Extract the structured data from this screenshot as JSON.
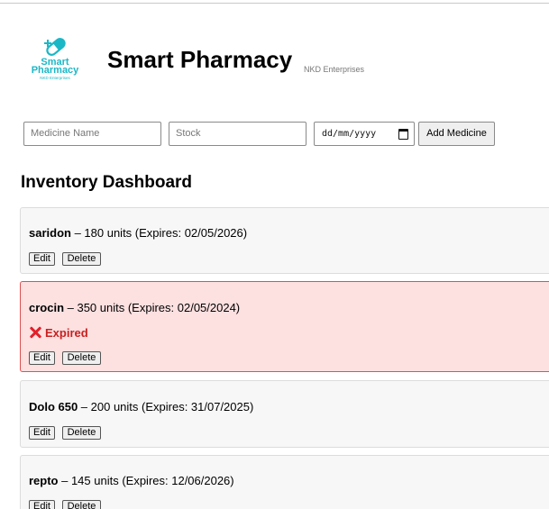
{
  "header": {
    "logo_name_line1": "Smart",
    "logo_name_line2": "Pharmacy",
    "logo_subtitle": "NKD Enterprises",
    "title": "Smart Pharmacy",
    "company": "NKD Enterprises"
  },
  "form": {
    "name_placeholder": "Medicine Name",
    "stock_placeholder": "Stock",
    "date_placeholder": "dd/mm/yyyy",
    "add_label": "Add Medicine"
  },
  "dashboard": {
    "title": "Inventory Dashboard",
    "edit_label": "Edit",
    "delete_label": "Delete",
    "medicines": [
      {
        "name": "saridon",
        "details": " – 180 units (Expires: 02/05/2026)",
        "expired": false
      },
      {
        "name": "crocin",
        "details": " – 350 units (Expires: 02/05/2024)",
        "expired": true,
        "status": "Expired"
      },
      {
        "name": "Dolo 650",
        "details": " – 200 units (Expires: 31/07/2025)",
        "expired": false
      },
      {
        "name": "repto",
        "details": " – 145 units (Expires: 12/06/2026)",
        "expired": false
      }
    ]
  },
  "colors": {
    "brand": "#1bb7c6",
    "expired_bg": "#fde0e0",
    "expired_border": "#de5151",
    "expired_text": "#c92020"
  }
}
